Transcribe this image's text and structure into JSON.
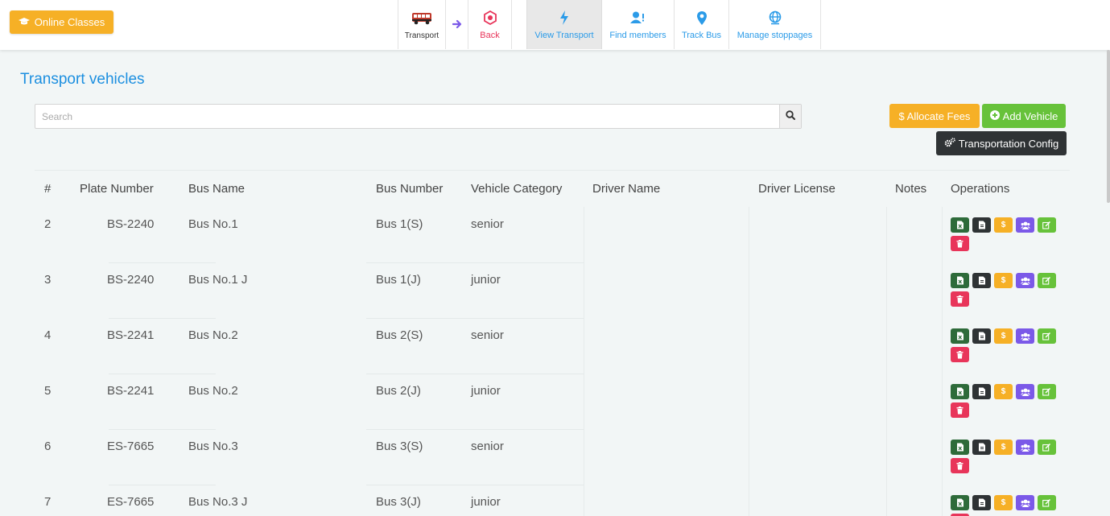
{
  "topbar": {
    "online_classes_label": "Online Classes",
    "nav": {
      "transport_label": "Transport",
      "back_label": "Back",
      "view_transport_label": "View Transport",
      "find_members_label": "Find members",
      "track_bus_label": "Track Bus",
      "manage_stoppages_label": "Manage stoppages"
    }
  },
  "page": {
    "title": "Transport vehicles",
    "search_placeholder": "Search",
    "allocate_fees_label": "$ Allocate Fees",
    "add_vehicle_label": "Add Vehicle",
    "transportation_config_label": "Transportation Config"
  },
  "table": {
    "headers": [
      "#",
      "Plate Number",
      "Bus Name",
      "Bus Number",
      "Vehicle Category",
      "Driver Name",
      "Driver License",
      "Notes",
      "Operations"
    ],
    "rows": [
      {
        "num": "2",
        "plate": "BS-2240",
        "bus_name": "Bus No.1",
        "bus_number": "Bus 1(S)",
        "category": "senior",
        "driver": "",
        "license": "",
        "notes": ""
      },
      {
        "num": "3",
        "plate": "BS-2240",
        "bus_name": "Bus No.1 J",
        "bus_number": "Bus 1(J)",
        "category": "junior",
        "driver": "",
        "license": "",
        "notes": ""
      },
      {
        "num": "4",
        "plate": "BS-2241",
        "bus_name": "Bus No.2",
        "bus_number": "Bus 2(S)",
        "category": "senior",
        "driver": "",
        "license": "",
        "notes": ""
      },
      {
        "num": "5",
        "plate": "BS-2241",
        "bus_name": "Bus No.2",
        "bus_number": "Bus 2(J)",
        "category": "junior",
        "driver": "",
        "license": "",
        "notes": ""
      },
      {
        "num": "6",
        "plate": "ES-7665",
        "bus_name": "Bus No.3",
        "bus_number": "Bus 3(S)",
        "category": "senior",
        "driver": "",
        "license": "",
        "notes": ""
      },
      {
        "num": "7",
        "plate": "ES-7665",
        "bus_name": "Bus No.3 J",
        "bus_number": "Bus 3(J)",
        "category": "junior",
        "driver": "",
        "license": "",
        "notes": ""
      }
    ],
    "operation_icons": [
      "export-excel-icon",
      "document-icon",
      "dollar-icon",
      "users-icon",
      "edit-icon",
      "delete-icon"
    ]
  },
  "colors": {
    "accent_blue": "#1c8fe0",
    "warning": "#f6b026",
    "success": "#67c23a",
    "dark": "#2f3335",
    "danger": "#e8355a",
    "purple": "#7b59e8",
    "dark_green": "#2e6b3a"
  }
}
